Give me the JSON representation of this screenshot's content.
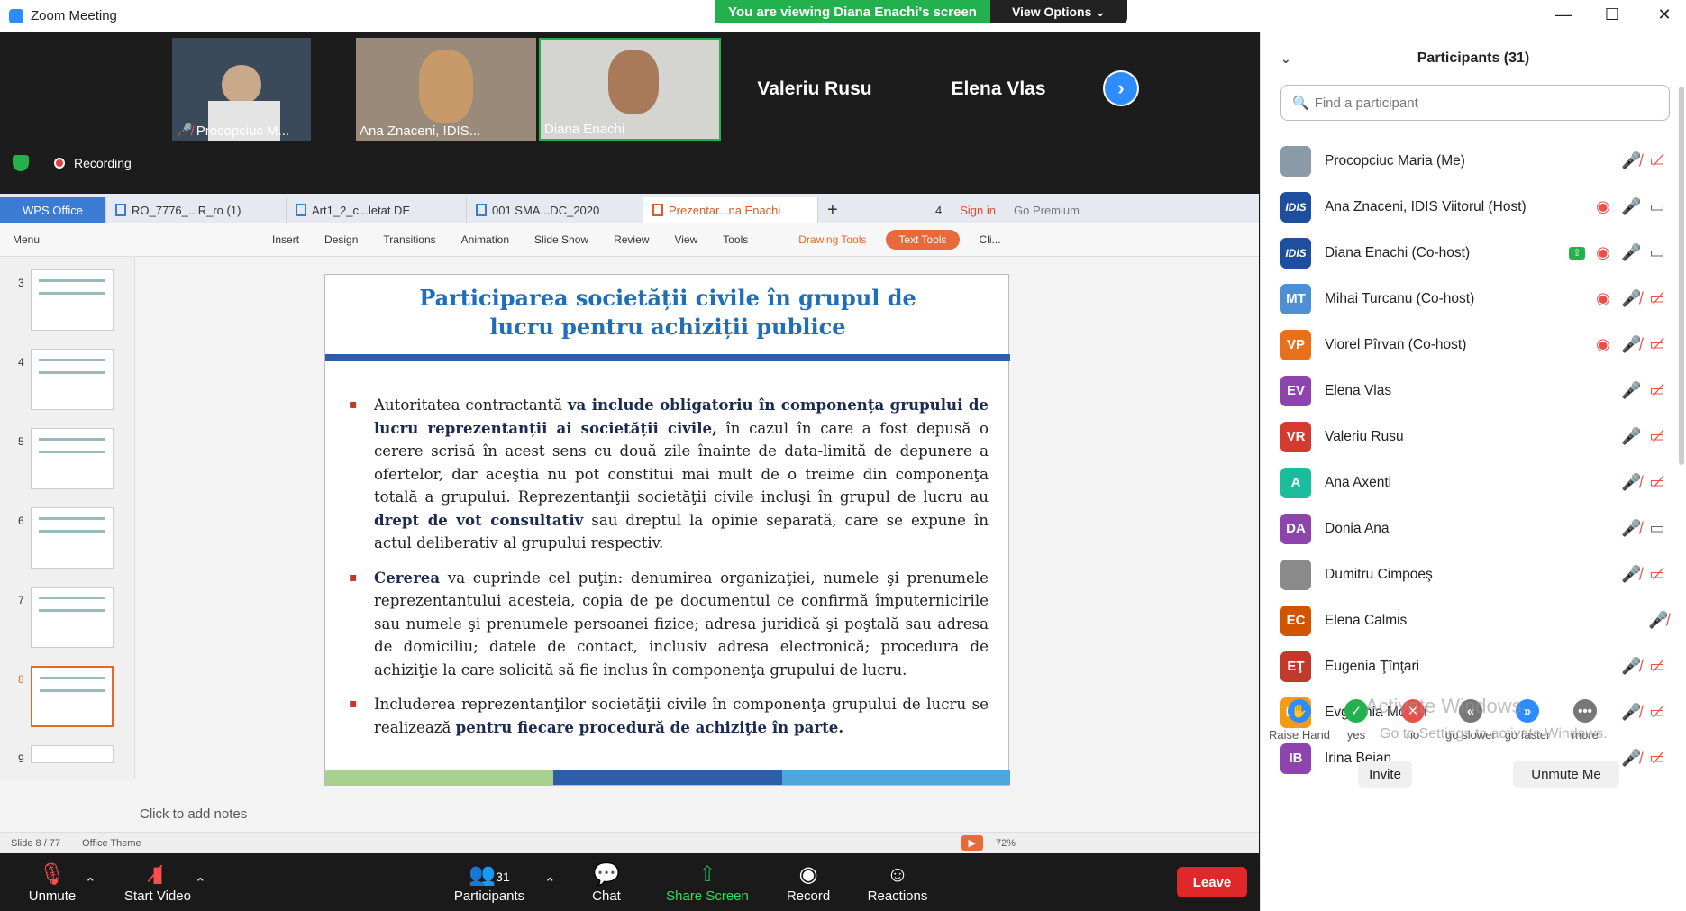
{
  "window": {
    "title": "Zoom Meeting",
    "viewing_banner": "You are viewing Diana Enachi's screen",
    "view_options": "View Options ⌄"
  },
  "video_strip": {
    "tiles": [
      {
        "label": "Procopciuc M...",
        "muted": true
      },
      {
        "label": "Ana Znaceni, IDIS...",
        "muted": false
      },
      {
        "label": "Diana Enachi",
        "muted": false
      }
    ],
    "name_tiles": [
      "Valeriu Rusu",
      "Elena Vlas"
    ],
    "recording_label": "Recording"
  },
  "wps": {
    "tabs": [
      {
        "label": "WPS Office"
      },
      {
        "label": "RO_7776_...R_ro (1)"
      },
      {
        "label": "Art1_2_c...letat DE"
      },
      {
        "label": "001 SMA...DC_2020"
      },
      {
        "label": "Prezentar...na Enachi"
      }
    ],
    "tab_count": "4",
    "sign_in": "Sign in",
    "go_premium": "Go Premium",
    "ribbon": [
      "Menu",
      "Insert",
      "Design",
      "Transitions",
      "Animation",
      "Slide Show",
      "Review",
      "View",
      "Tools",
      "Drawing Tools",
      "Text Tools",
      "Cli..."
    ],
    "thumb_numbers": [
      "3",
      "4",
      "5",
      "6",
      "7",
      "8",
      "9"
    ],
    "selected_thumb": "8",
    "notes_placeholder": "Click to add notes",
    "status_slide": "Slide 8 / 77",
    "status_theme": "Office Theme",
    "zoom_level": "72%"
  },
  "slide": {
    "title_line1": "Participarea societății civile în grupul de",
    "title_line2": "lucru pentru achiziții publice",
    "para1_a": "Autoritatea contractantă ",
    "para1_b": "va include obligatoriu în componența grupului de lucru reprezentanții ai societății civile,",
    "para1_c": " în cazul în care a fost depusă o cerere scrisă în acest sens cu două zile înainte de data-limită de depunere a ofertelor, dar aceştia nu pot constitui mai mult de o treime din componenţa totală a grupului. Reprezentanţii societăţii civile incluşi în grupul de lucru au ",
    "para1_d": "drept de vot consultativ",
    "para1_e": " sau dreptul la opinie separată, care se expune în actul deliberativ al grupului respectiv.",
    "para2_a": "Cererea",
    "para2_b": " va cuprinde cel puţin: denumirea organizaţiei, numele şi prenumele reprezentantului acesteia, copia de pe documentul ce confirmă împuternicirile sau numele şi prenumele persoanei fizice; adresa juridică şi poştală sau adresa de domiciliu; datele de contact, inclusiv adresa electronică; procedura de achiziţie la care solicită să fie inclus în componenţa grupului de lucru.",
    "para3_a": "Includerea reprezentanţilor societăţii civile în componenţa grupului de lucru se realizează ",
    "para3_b": "pentru fiecare procedură de achiziţie în parte.",
    "footer_colors": [
      "#a9d18e",
      "#2c5fa8",
      "#4ea6dc"
    ]
  },
  "toolbar": {
    "unmute": "Unmute",
    "start_video": "Start Video",
    "participants": "Participants",
    "participants_count": "31",
    "chat": "Chat",
    "share_screen": "Share Screen",
    "record": "Record",
    "reactions": "Reactions",
    "leave": "Leave"
  },
  "panel": {
    "title": "Participants (31)",
    "search_placeholder": "Find a participant",
    "participants": [
      {
        "name": "Procopciuc Maria (Me)",
        "initials": "",
        "color": "#8a9aa8",
        "kind": "photo",
        "icons": [
          "mic-off",
          "video-off"
        ]
      },
      {
        "name": "Ana Znaceni, IDIS Viitorul (Host)",
        "initials": "IDIS",
        "color": "#1d4f9e",
        "kind": "idis",
        "icons": [
          "rec",
          "mic",
          "video"
        ]
      },
      {
        "name": "Diana Enachi (Co-host)",
        "initials": "IDIS",
        "color": "#1d4f9e",
        "kind": "idis",
        "icons": [
          "share",
          "rec",
          "mic",
          "video"
        ]
      },
      {
        "name": "Mihai Turcanu (Co-host)",
        "initials": "MT",
        "color": "#4e8fd4",
        "kind": "init",
        "icons": [
          "rec",
          "mic-off",
          "video-off"
        ]
      },
      {
        "name": "Viorel Pîrvan (Co-host)",
        "initials": "VP",
        "color": "#e8701a",
        "kind": "init",
        "icons": [
          "rec",
          "mic-off",
          "video-off"
        ]
      },
      {
        "name": "Elena Vlas",
        "initials": "EV",
        "color": "#8e44ad",
        "kind": "init",
        "icons": [
          "mic",
          "video-off"
        ]
      },
      {
        "name": "Valeriu Rusu",
        "initials": "VR",
        "color": "#d63a2f",
        "kind": "init",
        "icons": [
          "mic",
          "video-off"
        ]
      },
      {
        "name": "Ana Axenti",
        "initials": "A",
        "color": "#1abc9c",
        "kind": "init",
        "icons": [
          "mic-off",
          "video-off"
        ]
      },
      {
        "name": "Donia Ana",
        "initials": "DA",
        "color": "#8e44ad",
        "kind": "init",
        "icons": [
          "mic-off",
          "video"
        ]
      },
      {
        "name": "Dumitru Cimpoeş",
        "initials": "",
        "color": "#8a8a8a",
        "kind": "photo",
        "icons": [
          "mic-off",
          "video-off"
        ]
      },
      {
        "name": "Elena Calmis",
        "initials": "EC",
        "color": "#d35400",
        "kind": "init",
        "icons": [
          "mic-off"
        ]
      },
      {
        "name": "Eugenia Ţînţari",
        "initials": "EŢ",
        "color": "#c0392b",
        "kind": "init",
        "icons": [
          "mic-off",
          "video-off"
        ]
      },
      {
        "name": "Evghenia Moisei",
        "initials": "EM",
        "color": "#f39c12",
        "kind": "init",
        "icons": [
          "mic-off",
          "video-off"
        ]
      },
      {
        "name": "Irina Bejan",
        "initials": "IB",
        "color": "#8e44ad",
        "kind": "init",
        "icons": [
          "mic-off",
          "video-off"
        ]
      }
    ],
    "reactions": [
      {
        "label": "Raise Hand",
        "color": "#2d8cff",
        "glyph": "✋"
      },
      {
        "label": "yes",
        "color": "#23b14d",
        "glyph": "✓"
      },
      {
        "label": "no",
        "color": "#e8504a",
        "glyph": "✕"
      },
      {
        "label": "go slower",
        "color": "#777777",
        "glyph": "«"
      },
      {
        "label": "go faster",
        "color": "#2d8cff",
        "glyph": "»"
      },
      {
        "label": "more",
        "color": "#777777",
        "glyph": "•••"
      }
    ],
    "activate_title": "Activate Windows",
    "activate_sub": "Go to Settings to activate Windows.",
    "invite": "Invite",
    "unmute_me": "Unmute Me"
  }
}
